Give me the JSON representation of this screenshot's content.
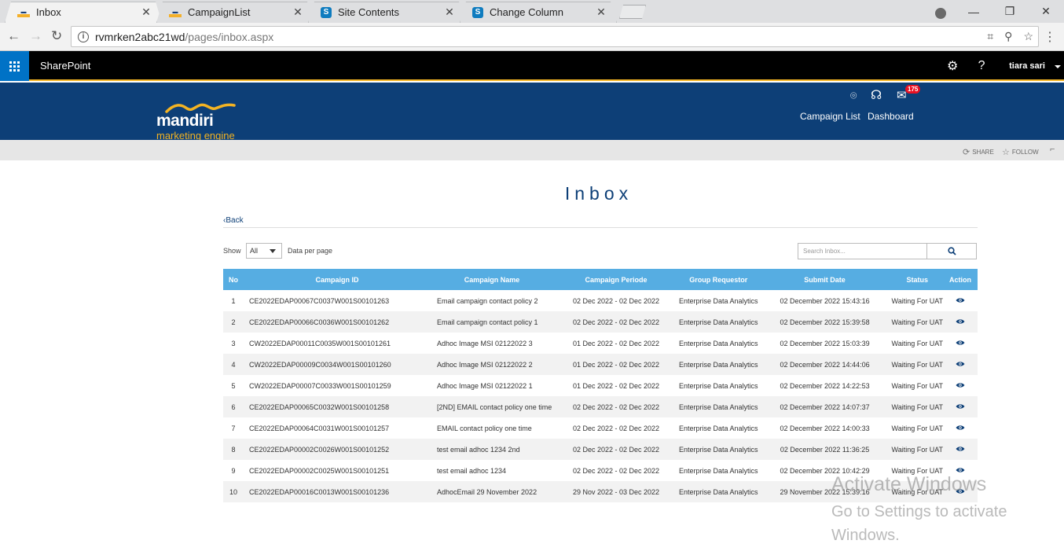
{
  "browser": {
    "tabs": [
      {
        "label": "Inbox",
        "active": true,
        "favicon": "mandiri-favicon"
      },
      {
        "label": "CampaignList",
        "active": false,
        "favicon": "mandiri-favicon"
      },
      {
        "label": "Site Contents",
        "active": false,
        "favicon": "sharepoint-favicon"
      },
      {
        "label": "Change Column",
        "active": false,
        "favicon": "sharepoint-favicon"
      }
    ],
    "url_host": "rvmrken2abc21wd",
    "url_path": "/pages/inbox.aspx"
  },
  "suitebar": {
    "title": "SharePoint",
    "user": "tiara sari",
    "accent": "#0072c6"
  },
  "brand": {
    "name": "mandiri",
    "sub": "marketing engine",
    "mail_count": "175",
    "nav": [
      "Campaign List",
      "Dashboard"
    ],
    "color": "#0d3f77",
    "accent": "#f3b323"
  },
  "cmd": {
    "share": "SHARE",
    "follow": "FOLLOW"
  },
  "page": {
    "title": "Inbox",
    "back": "Back",
    "show": "Show",
    "per_page_value": "All",
    "per_page_suffix": "Data per page",
    "search_placeholder": "Search Inbox..."
  },
  "table": {
    "headers": [
      "No",
      "Campaign ID",
      "Campaign Name",
      "Campaign Periode",
      "Group Requestor",
      "Submit Date",
      "Status",
      "Action"
    ],
    "header_color": "#56ade2",
    "rows": [
      [
        "1",
        "CE2022EDAP00067C0037W001S00101263",
        "Email campaign contact policy 2",
        "02 Dec 2022 - 02 Dec 2022",
        "Enterprise Data Analytics",
        "02 December 2022 15:43:16",
        "Waiting For UAT"
      ],
      [
        "2",
        "CE2022EDAP00066C0036W001S00101262",
        "Email campaign contact policy 1",
        "02 Dec 2022 - 02 Dec 2022",
        "Enterprise Data Analytics",
        "02 December 2022 15:39:58",
        "Waiting For UAT"
      ],
      [
        "3",
        "CW2022EDAP00011C0035W001S00101261",
        "Adhoc Image MSI 02122022 3",
        "01 Dec 2022 - 02 Dec 2022",
        "Enterprise Data Analytics",
        "02 December 2022 15:03:39",
        "Waiting For UAT"
      ],
      [
        "4",
        "CW2022EDAP00009C0034W001S00101260",
        "Adhoc Image MSI 02122022 2",
        "01 Dec 2022 - 02 Dec 2022",
        "Enterprise Data Analytics",
        "02 December 2022 14:44:06",
        "Waiting For UAT"
      ],
      [
        "5",
        "CW2022EDAP00007C0033W001S00101259",
        "Adhoc Image MSI 02122022 1",
        "01 Dec 2022 - 02 Dec 2022",
        "Enterprise Data Analytics",
        "02 December 2022 14:22:53",
        "Waiting For UAT"
      ],
      [
        "6",
        "CE2022EDAP00065C0032W001S00101258",
        "[2ND] EMAIL contact policy one time",
        "02 Dec 2022 - 02 Dec 2022",
        "Enterprise Data Analytics",
        "02 December 2022 14:07:37",
        "Waiting For UAT"
      ],
      [
        "7",
        "CE2022EDAP00064C0031W001S00101257",
        "EMAIL contact policy one time",
        "02 Dec 2022 - 02 Dec 2022",
        "Enterprise Data Analytics",
        "02 December 2022 14:00:33",
        "Waiting For UAT"
      ],
      [
        "8",
        "CE2022EDAP00002C0026W001S00101252",
        "test email adhoc 1234 2nd",
        "02 Dec 2022 - 02 Dec 2022",
        "Enterprise Data Analytics",
        "02 December 2022 11:36:25",
        "Waiting For UAT"
      ],
      [
        "9",
        "CE2022EDAP00002C0025W001S00101251",
        "test email adhoc 1234",
        "02 Dec 2022 - 02 Dec 2022",
        "Enterprise Data Analytics",
        "02 December 2022 10:42:29",
        "Waiting For UAT"
      ],
      [
        "10",
        "CE2022EDAP00016C0013W001S00101236",
        "AdhocEmail 29 November 2022",
        "29 Nov 2022 - 03 Dec 2022",
        "Enterprise Data Analytics",
        "29 November 2022 15:39:16",
        "Waiting For UAT"
      ]
    ],
    "action_icon": "eye-icon"
  },
  "watermark": {
    "line1": "Activate Windows",
    "line2": "Go to Settings to activate",
    "line3": "Windows."
  }
}
